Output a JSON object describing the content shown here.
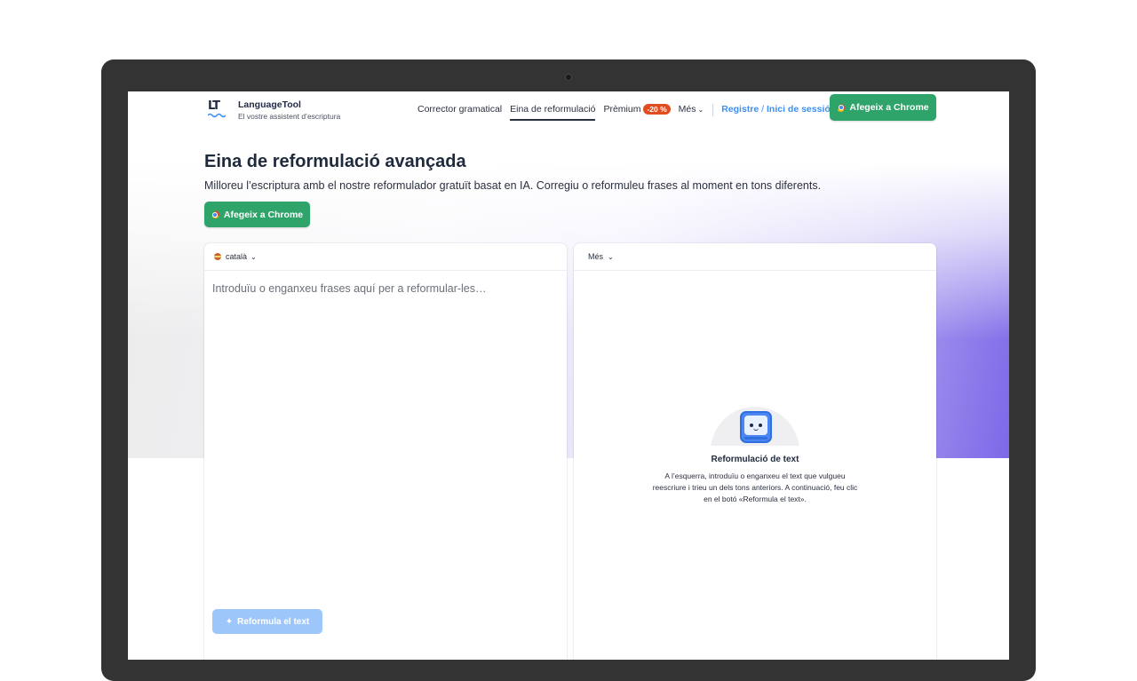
{
  "header": {
    "logo_mark": "LT",
    "brand_name": "LanguageTool",
    "brand_tagline": "El vostre assistent d’escriptura",
    "nav": {
      "grammar": "Corrector gramatical",
      "rephrase": "Eina de reformulació",
      "premium": "Prèmium",
      "premium_badge": "-20 %",
      "more": "Més",
      "register": "Registre",
      "login": "Inici de sessió"
    },
    "chrome_button": "Afegeix a Chrome"
  },
  "hero": {
    "title": "Eina de reformulació avançada",
    "subtitle": "Milloreu l’escriptura amb el nostre reformulador gratuït basat en IA. Corregiu o reformuleu frases al moment en tons diferents.",
    "chrome_button": "Afegeix a Chrome"
  },
  "editor": {
    "language": "català",
    "placeholder": "Introduïu o enganxeu frases aquí per a reformular-les…",
    "rephrase_button": "Reformula el text"
  },
  "output": {
    "tone_menu": "Més",
    "empty_title": "Reformulació de text",
    "empty_description": "A l’esquerra, introduïu o enganxeu el text que vulgueu reescriure i trieu un dels tons anteriors. A continuació, feu clic en el botó «Reformula el text»."
  },
  "colors": {
    "brand_green": "#2ea36a",
    "link_blue": "#3d8ff2",
    "badge_orange": "#e24d1f",
    "disabled_blue": "#9dc7fb"
  },
  "icons": [
    "languagetool-logo-icon",
    "chrome-icon",
    "chevron-down-icon",
    "language-flag-icon",
    "sparkle-icon",
    "robot-illustration-icon"
  ]
}
